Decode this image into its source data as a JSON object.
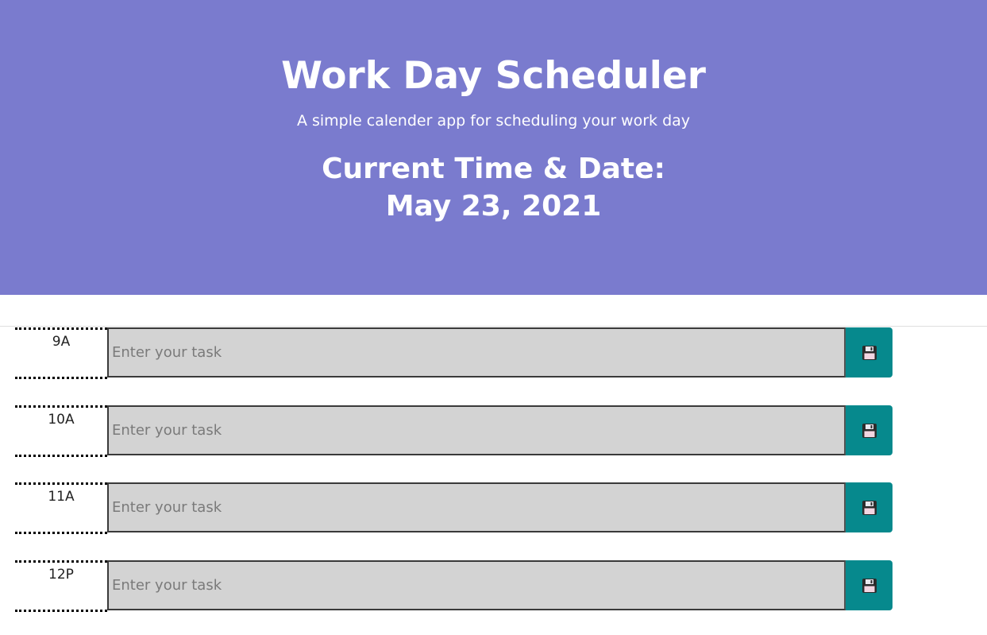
{
  "header": {
    "title": "Work Day Scheduler",
    "subtitle": "A simple calender app for scheduling your work day",
    "current_label": "Current Time & Date:",
    "current_date": "May 23, 2021"
  },
  "schedule": {
    "rows": [
      {
        "hour": "9A",
        "task_value": "",
        "task_placeholder": "Enter your task",
        "save_icon": "floppy-disk-icon"
      },
      {
        "hour": "10A",
        "task_value": "",
        "task_placeholder": "Enter your task",
        "save_icon": "floppy-disk-icon"
      },
      {
        "hour": "11A",
        "task_value": "",
        "task_placeholder": "Enter your task",
        "save_icon": "floppy-disk-icon"
      },
      {
        "hour": "12P",
        "task_value": "",
        "task_placeholder": "Enter your task",
        "save_icon": "floppy-disk-icon"
      }
    ]
  },
  "colors": {
    "header_background": "#7a7bce",
    "header_text": "#ffffff",
    "task_background": "#d3d3d3",
    "save_button": "#06898d"
  }
}
